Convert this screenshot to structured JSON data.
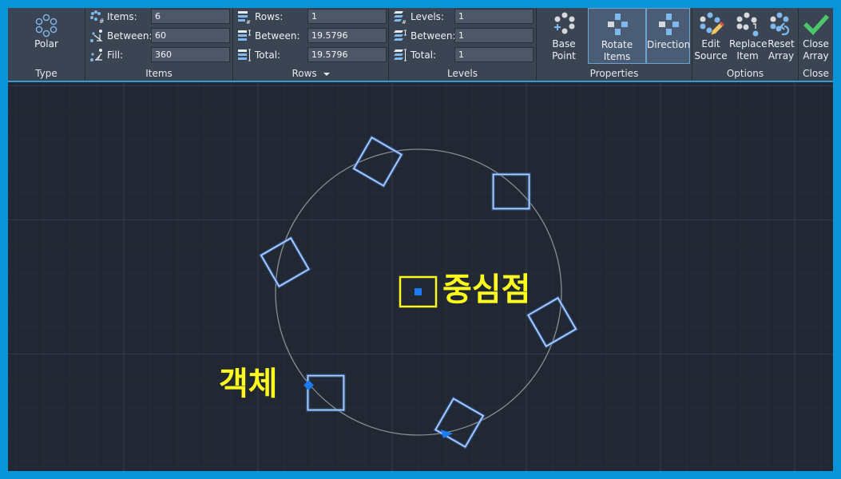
{
  "ribbon": {
    "type_panel": {
      "title": "Type",
      "button_label": "Polar",
      "icon": "polar-array-icon"
    },
    "items_panel": {
      "title": "Items",
      "fields": [
        {
          "label": "Items:",
          "value": "6",
          "icon": "items-count-icon"
        },
        {
          "label": "Between:",
          "value": "60",
          "icon": "angle-between-icon"
        },
        {
          "label": "Fill:",
          "value": "360",
          "icon": "fill-angle-icon"
        }
      ]
    },
    "rows_panel": {
      "title": "Rows",
      "has_dropdown": true,
      "fields": [
        {
          "label": "Rows:",
          "value": "1",
          "icon": "rows-count-icon"
        },
        {
          "label": "Between:",
          "value": "19.5796",
          "icon": "rows-between-icon"
        },
        {
          "label": "Total:",
          "value": "19.5796",
          "icon": "rows-total-icon"
        }
      ]
    },
    "levels_panel": {
      "title": "Levels",
      "fields": [
        {
          "label": "Levels:",
          "value": "1",
          "icon": "levels-count-icon"
        },
        {
          "label": "Between:",
          "value": "1",
          "icon": "levels-between-icon"
        },
        {
          "label": "Total:",
          "value": "1",
          "icon": "levels-total-icon"
        }
      ]
    },
    "properties_panel": {
      "title": "Properties",
      "buttons": [
        {
          "label": "Base Point",
          "active": false,
          "icon": "base-point-icon"
        },
        {
          "label": "Rotate Items",
          "active": true,
          "icon": "rotate-items-icon"
        },
        {
          "label": "Direction",
          "active": true,
          "icon": "direction-icon"
        }
      ]
    },
    "options_panel": {
      "title": "Options",
      "buttons": [
        {
          "label_line1": "Edit",
          "label_line2": "Source",
          "icon": "edit-source-icon"
        },
        {
          "label_line1": "Replace",
          "label_line2": "Item",
          "icon": "replace-item-icon"
        },
        {
          "label_line1": "Reset",
          "label_line2": "Array",
          "icon": "reset-array-icon"
        }
      ]
    },
    "close_panel": {
      "title": "Close",
      "button": {
        "label_line1": "Close",
        "label_line2": "Array",
        "icon": "checkmark-icon"
      }
    }
  },
  "canvas": {
    "annotations": {
      "center_label": "중심점",
      "object_label": "객체"
    },
    "array_item_count": 6,
    "colors": {
      "background": "#212833",
      "grid_minor": "#262e3a",
      "grid_major": "#323b49",
      "circle": "#8a8d92",
      "selection": "#6ea8ff",
      "annotation": "#fbf91e",
      "grip": "#1a7cf2"
    }
  }
}
